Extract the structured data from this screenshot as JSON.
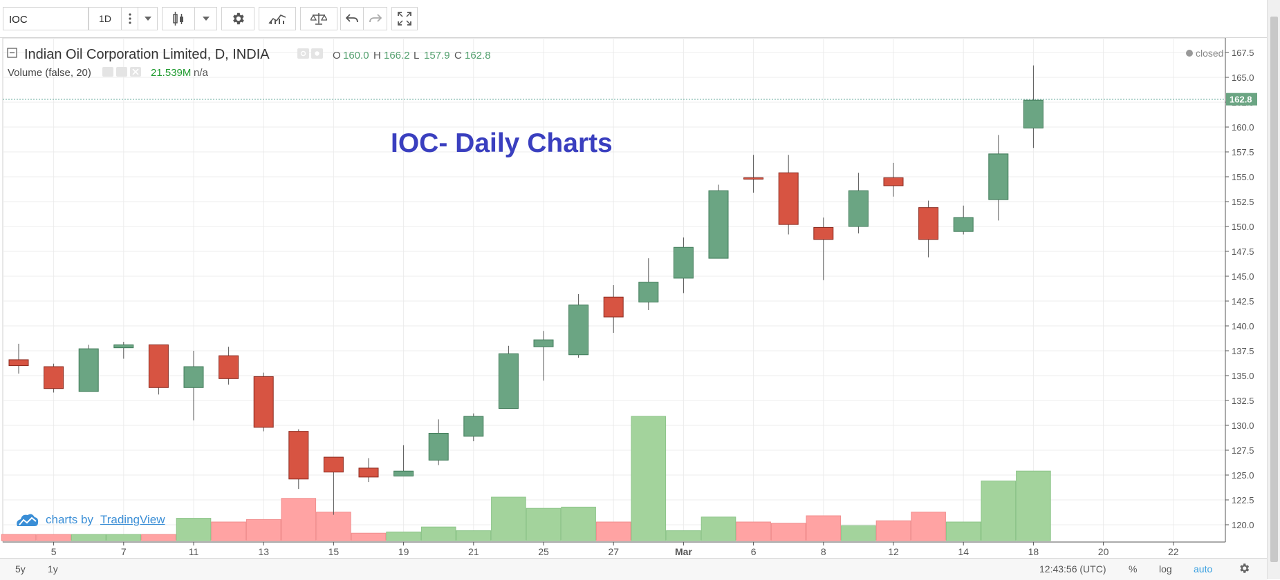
{
  "toolbar": {
    "symbol": "IOC",
    "interval": "1D",
    "icons": [
      "more-vert-icon",
      "dropdown-arrow-icon",
      "candles-icon",
      "settings-gear-icon",
      "indicators-icon",
      "compare-scale-icon",
      "undo-icon",
      "redo-icon",
      "fullscreen-icon"
    ]
  },
  "legend": {
    "title": "Indian Oil Corporation Limited, D, INDIA",
    "o_label": "O",
    "o_value": "160.0",
    "h_label": "H",
    "h_value": "166.2",
    "l_label": "L",
    "l_value": "157.9",
    "c_label": "C",
    "c_value": "162.8",
    "volume_label": "Volume (false, 20)",
    "volume_value": "21.539M",
    "volume_na": "n/a",
    "status": "closed"
  },
  "annotation": "IOC- Daily Charts",
  "last_price_label": "162.8",
  "watermark": {
    "prefix": "charts by",
    "link": "TradingView"
  },
  "bottombar": {
    "range_5y": "5y",
    "range_1y": "1y",
    "time": "12:43:56 (UTC)",
    "percent": "%",
    "log": "log",
    "auto": "auto"
  },
  "colors": {
    "up": "#6ba583",
    "down": "#d75442",
    "vol_up": "#a3d39c",
    "vol_down": "#ffa3a3",
    "annotation": "#3a3fbf",
    "price_line": "#4a9a8a"
  },
  "chart_data": {
    "type": "candlestick",
    "y_axis": {
      "min": 118.5,
      "max": 168,
      "ticks": [
        "120.0",
        "122.5",
        "125.0",
        "127.5",
        "130.0",
        "132.5",
        "135.0",
        "137.5",
        "140.0",
        "142.5",
        "145.0",
        "147.5",
        "150.0",
        "152.5",
        "155.0",
        "157.5",
        "160.0",
        "162.5",
        "165.0",
        "167.5"
      ]
    },
    "x_tick_labels": [
      {
        "label": "5",
        "index": 1
      },
      {
        "label": "7",
        "index": 3
      },
      {
        "label": "11",
        "index": 5
      },
      {
        "label": "13",
        "index": 7
      },
      {
        "label": "15",
        "index": 9
      },
      {
        "label": "19",
        "index": 11
      },
      {
        "label": "21",
        "index": 13
      },
      {
        "label": "25",
        "index": 15
      },
      {
        "label": "27",
        "index": 17
      },
      {
        "label": "Mar",
        "index": 19
      },
      {
        "label": "6",
        "index": 21
      },
      {
        "label": "8",
        "index": 23
      },
      {
        "label": "12",
        "index": 25
      },
      {
        "label": "14",
        "index": 27
      },
      {
        "label": "18",
        "index": 29
      },
      {
        "label": "20",
        "index": 31
      },
      {
        "label": "22",
        "index": 33
      }
    ],
    "candles": [
      {
        "o": 136.6,
        "h": 138.2,
        "l": 135.2,
        "c": 136.0
      },
      {
        "o": 135.9,
        "h": 136.2,
        "l": 133.3,
        "c": 133.7
      },
      {
        "o": 133.4,
        "h": 138.1,
        "l": 133.4,
        "c": 137.7
      },
      {
        "o": 137.8,
        "h": 138.4,
        "l": 136.7,
        "c": 138.1
      },
      {
        "o": 138.1,
        "h": 138.1,
        "l": 133.1,
        "c": 133.8
      },
      {
        "o": 133.8,
        "h": 137.5,
        "l": 130.5,
        "c": 135.9
      },
      {
        "o": 137.0,
        "h": 137.9,
        "l": 134.1,
        "c": 134.7
      },
      {
        "o": 134.9,
        "h": 135.3,
        "l": 129.4,
        "c": 129.8
      },
      {
        "o": 129.4,
        "h": 129.6,
        "l": 123.6,
        "c": 124.6
      },
      {
        "o": 126.8,
        "h": 126.8,
        "l": 121.0,
        "c": 125.3
      },
      {
        "o": 125.7,
        "h": 126.7,
        "l": 124.3,
        "c": 124.8
      },
      {
        "o": 124.9,
        "h": 128.0,
        "l": 124.9,
        "c": 125.4
      },
      {
        "o": 126.5,
        "h": 130.6,
        "l": 126.0,
        "c": 129.2
      },
      {
        "o": 128.9,
        "h": 131.2,
        "l": 128.4,
        "c": 130.9
      },
      {
        "o": 131.7,
        "h": 138.0,
        "l": 131.7,
        "c": 137.2
      },
      {
        "o": 137.9,
        "h": 139.5,
        "l": 134.5,
        "c": 138.6
      },
      {
        "o": 137.1,
        "h": 143.2,
        "l": 136.8,
        "c": 142.1
      },
      {
        "o": 142.9,
        "h": 144.1,
        "l": 139.3,
        "c": 140.9
      },
      {
        "o": 142.4,
        "h": 146.8,
        "l": 141.6,
        "c": 144.4
      },
      {
        "o": 144.8,
        "h": 148.9,
        "l": 143.3,
        "c": 147.9
      },
      {
        "o": 146.8,
        "h": 154.2,
        "l": 146.8,
        "c": 153.6
      },
      {
        "o": 154.9,
        "h": 157.2,
        "l": 153.4,
        "c": 154.8
      },
      {
        "o": 155.4,
        "h": 157.2,
        "l": 149.2,
        "c": 150.2
      },
      {
        "o": 149.9,
        "h": 150.9,
        "l": 144.6,
        "c": 148.7
      },
      {
        "o": 150.0,
        "h": 155.4,
        "l": 149.3,
        "c": 153.6
      },
      {
        "o": 154.9,
        "h": 156.4,
        "l": 153.0,
        "c": 154.1
      },
      {
        "o": 151.9,
        "h": 152.6,
        "l": 146.9,
        "c": 148.7
      },
      {
        "o": 149.5,
        "h": 152.1,
        "l": 149.2,
        "c": 150.9
      },
      {
        "o": 152.7,
        "h": 159.2,
        "l": 150.6,
        "c": 157.3
      },
      {
        "o": 159.9,
        "h": 166.2,
        "l": 157.9,
        "c": 162.7
      }
    ],
    "volume_note": "relative bar heights (0-1) for volume histogram",
    "volume": [
      {
        "v": 0.05,
        "up": false
      },
      {
        "v": 0.05,
        "up": false
      },
      {
        "v": 0.05,
        "up": true
      },
      {
        "v": 0.05,
        "up": true
      },
      {
        "v": 0.05,
        "up": false
      },
      {
        "v": 0.18,
        "up": true
      },
      {
        "v": 0.15,
        "up": false
      },
      {
        "v": 0.17,
        "up": false
      },
      {
        "v": 0.34,
        "up": false
      },
      {
        "v": 0.23,
        "up": false
      },
      {
        "v": 0.06,
        "up": false
      },
      {
        "v": 0.07,
        "up": true
      },
      {
        "v": 0.11,
        "up": true
      },
      {
        "v": 0.08,
        "up": true
      },
      {
        "v": 0.35,
        "up": true
      },
      {
        "v": 0.26,
        "up": true
      },
      {
        "v": 0.27,
        "up": true
      },
      {
        "v": 0.15,
        "up": false
      },
      {
        "v": 1.0,
        "up": true
      },
      {
        "v": 0.08,
        "up": true
      },
      {
        "v": 0.19,
        "up": true
      },
      {
        "v": 0.15,
        "up": false
      },
      {
        "v": 0.14,
        "up": false
      },
      {
        "v": 0.2,
        "up": false
      },
      {
        "v": 0.12,
        "up": true
      },
      {
        "v": 0.16,
        "up": false
      },
      {
        "v": 0.23,
        "up": false
      },
      {
        "v": 0.15,
        "up": true
      },
      {
        "v": 0.48,
        "up": true
      },
      {
        "v": 0.56,
        "up": true
      }
    ]
  }
}
